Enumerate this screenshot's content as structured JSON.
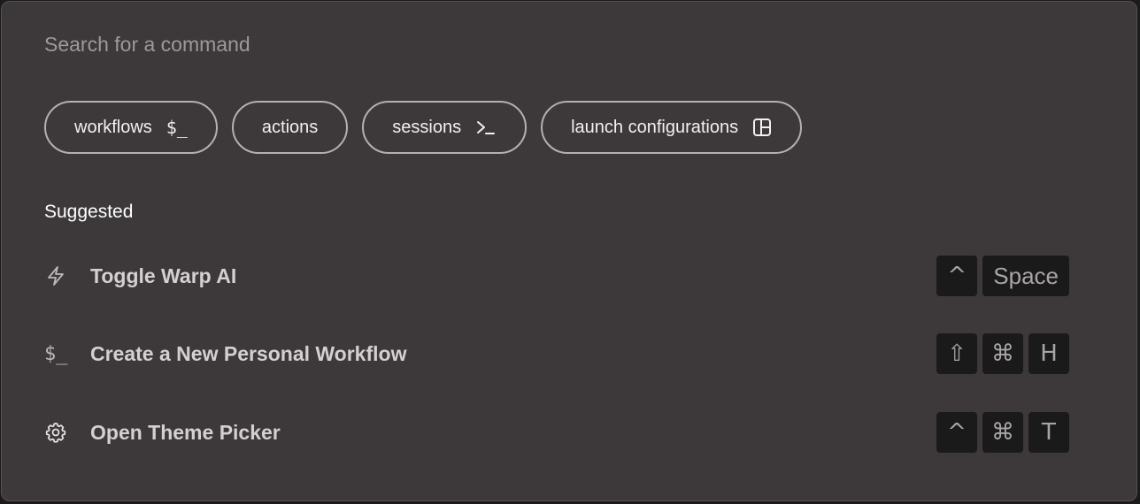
{
  "search": {
    "placeholder": "Search for a command",
    "value": ""
  },
  "filters": [
    {
      "label": "workflows",
      "icon": "dollar-prompt-icon",
      "icon_text": "$_"
    },
    {
      "label": "actions",
      "icon": null,
      "icon_text": ""
    },
    {
      "label": "sessions",
      "icon": "terminal-prompt-icon",
      "icon_text": ""
    },
    {
      "label": "launch configurations",
      "icon": "layout-icon",
      "icon_text": ""
    }
  ],
  "suggested": {
    "title": "Suggested",
    "items": [
      {
        "label": "Toggle Warp AI",
        "icon": "lightning-icon",
        "keys": [
          "^",
          "Space"
        ]
      },
      {
        "label": "Create a New Personal Workflow",
        "icon": "dollar-prompt-icon",
        "icon_text": "$_",
        "keys": [
          "⇧",
          "⌘",
          "H"
        ]
      },
      {
        "label": "Open Theme Picker",
        "icon": "gear-icon",
        "keys": [
          "^",
          "⌘",
          "T"
        ]
      }
    ]
  },
  "colors": {
    "panel_bg": "#3d393a",
    "chip_border": "#b5b1b2",
    "key_bg": "#1b1a1a"
  }
}
